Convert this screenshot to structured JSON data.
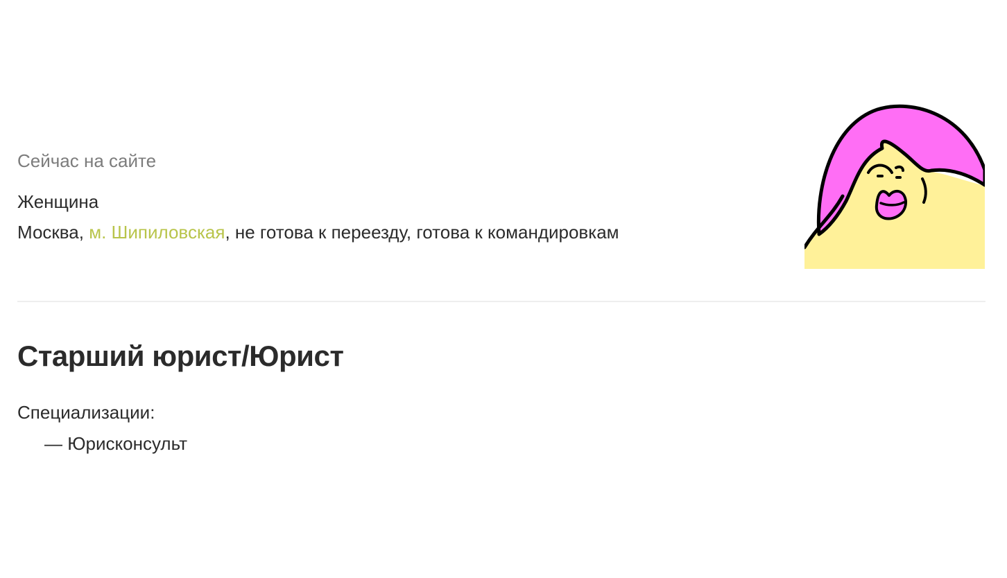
{
  "profile": {
    "status": "Сейчас на сайте",
    "gender": "Женщина",
    "city": "Москва",
    "city_separator": ", ",
    "metro": "м. Шипиловская",
    "relocation_and_travel": ", не готова к переезду, готова к командировкам",
    "avatar_icon": "female-avatar-illustration"
  },
  "resume": {
    "title": "Старший юрист/Юрист",
    "specializations_label": "Специализации:",
    "specializations_prefix": "— ",
    "specializations": [
      "Юрисконсульт"
    ]
  },
  "colors": {
    "metro_link": "#b8c44a",
    "status_text": "#7c7c7c",
    "avatar_hair": "#ff6ef5",
    "avatar_skin": "#fff199"
  }
}
